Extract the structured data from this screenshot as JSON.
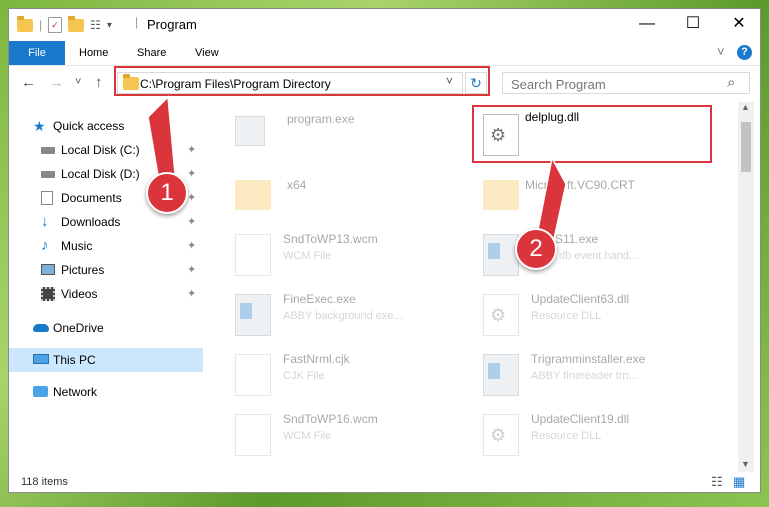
{
  "window": {
    "title": "Program"
  },
  "titlebar": {
    "minimize": "—",
    "maximize": "☐",
    "close": "✕"
  },
  "ribbon": {
    "tabs": [
      "File",
      "Home",
      "Share",
      "View"
    ],
    "expand_icon": "˅",
    "help_icon": "?"
  },
  "nav": {
    "back": "←",
    "forward": "→",
    "up": "↑",
    "recent": "˅",
    "address": "C:\\Program Files\\Program Directory",
    "refresh": "↻",
    "search_placeholder": "Search Program",
    "search_icon": "⌕"
  },
  "sidebar": {
    "items": [
      {
        "label": "Quick access",
        "icon": "star-icon",
        "pinned": false
      },
      {
        "label": "Local Disk (C:)",
        "icon": "drive-icon",
        "pinned": true
      },
      {
        "label": "Local Disk (D:)",
        "icon": "drive-icon",
        "pinned": true
      },
      {
        "label": "Documents",
        "icon": "documents-icon",
        "pinned": true
      },
      {
        "label": "Downloads",
        "icon": "download-icon",
        "pinned": true
      },
      {
        "label": "Music",
        "icon": "music-icon",
        "pinned": true
      },
      {
        "label": "Pictures",
        "icon": "pictures-icon",
        "pinned": true
      },
      {
        "label": "Videos",
        "icon": "videos-icon",
        "pinned": true
      },
      {
        "label": "OneDrive",
        "icon": "cloud-icon",
        "pinned": false
      },
      {
        "label": "This PC",
        "icon": "pc-icon",
        "pinned": false,
        "selected": true
      },
      {
        "label": "Network",
        "icon": "network-icon",
        "pinned": false
      }
    ],
    "pin_glyph": "📌"
  },
  "files": [
    {
      "name": "program.exe",
      "sub": "",
      "type": "exe"
    },
    {
      "name": "delplug.dll",
      "sub": "",
      "type": "dll",
      "highlighted": true
    },
    {
      "name": "x64",
      "sub": "",
      "type": "folder"
    },
    {
      "name": "Microsoft.VC90.CRT",
      "sub": "",
      "type": "folder"
    },
    {
      "name": "SndToWP13.wcm",
      "sub": "WCM File",
      "type": "doc"
    },
    {
      "name": "xxyyS11.exe",
      "sub": "Abby db event hand...",
      "type": "exe"
    },
    {
      "name": "FineExec.exe",
      "sub": "ABBY background exe...",
      "type": "exe"
    },
    {
      "name": "UpdateClient63.dll",
      "sub": "Resource DLL",
      "type": "dll"
    },
    {
      "name": "FastNrml.cjk",
      "sub": "CJK File",
      "type": "doc"
    },
    {
      "name": "Trigramminstaller.exe",
      "sub": "ABBY finereader trn...",
      "type": "exe"
    },
    {
      "name": "SndToWP16.wcm",
      "sub": "WCM File",
      "type": "doc"
    },
    {
      "name": "UpdateClient19.dll",
      "sub": "Resource DLL",
      "type": "dll"
    }
  ],
  "status": {
    "count": "118 items",
    "details_icon": "☷",
    "tiles_icon": "▦"
  },
  "annotations": {
    "badge1": "1",
    "badge2": "2"
  },
  "colors": {
    "accent": "#1979ca",
    "highlight": "#d9353b",
    "selected": "#cce8ff"
  }
}
